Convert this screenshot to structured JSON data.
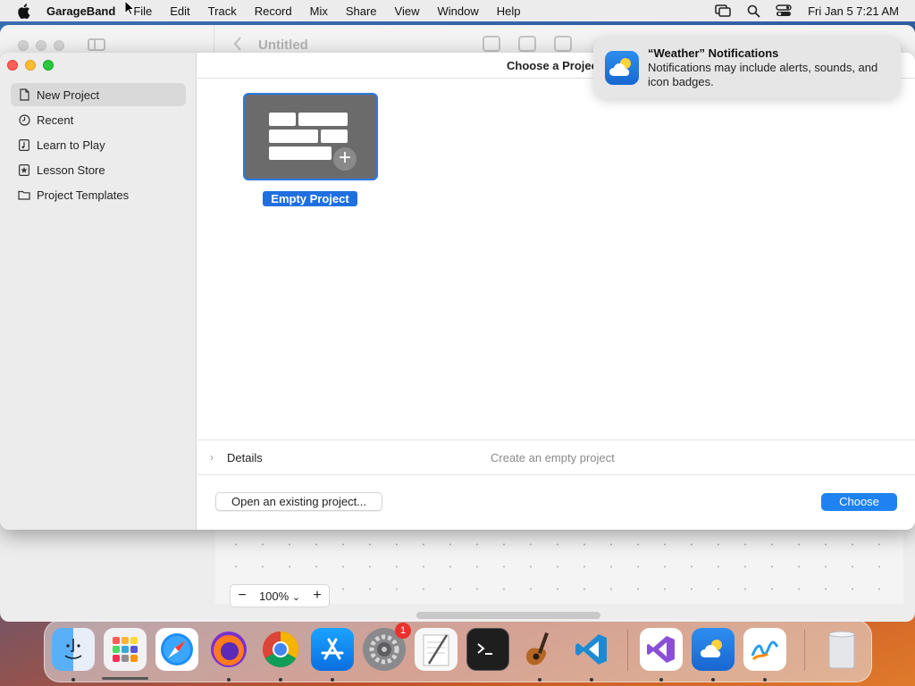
{
  "menubar": {
    "app_name": "GarageBand",
    "items": [
      "File",
      "Edit",
      "Track",
      "Record",
      "Mix",
      "Share",
      "View",
      "Window",
      "Help"
    ],
    "clock": "Fri Jan 5  7:21 AM"
  },
  "bg_window": {
    "title": "Untitled",
    "zoom_minus": "−",
    "zoom_value": "100%",
    "zoom_chevron": "⌄",
    "zoom_plus": "+"
  },
  "chooser": {
    "title": "Choose a Project",
    "sidebar": [
      {
        "label": "New Project",
        "icon": "document-icon"
      },
      {
        "label": "Recent",
        "icon": "clock-icon"
      },
      {
        "label": "Learn to Play",
        "icon": "music-note-icon"
      },
      {
        "label": "Lesson Store",
        "icon": "star-icon"
      },
      {
        "label": "Project Templates",
        "icon": "folder-icon"
      }
    ],
    "tile_label": "Empty Project",
    "details_label": "Details",
    "details_desc": "Create an empty project",
    "open_button": "Open an existing project...",
    "choose_button": "Choose"
  },
  "notification": {
    "title": "“Weather” Notifications",
    "body": "Notifications may include alerts, sounds, and icon badges."
  },
  "dock": {
    "items": [
      "Finder",
      "Launchpad",
      "Safari",
      "Firefox",
      "Chrome",
      "App Store",
      "System Settings",
      "TextEdit",
      "Terminal",
      "GarageBand",
      "VS Code",
      "Visual Studio",
      "Weather",
      "Freeform",
      "Trash"
    ],
    "settings_badge": "1"
  },
  "colors": {
    "accent": "#1f82f2",
    "selected_tile": "#2a78e4"
  }
}
